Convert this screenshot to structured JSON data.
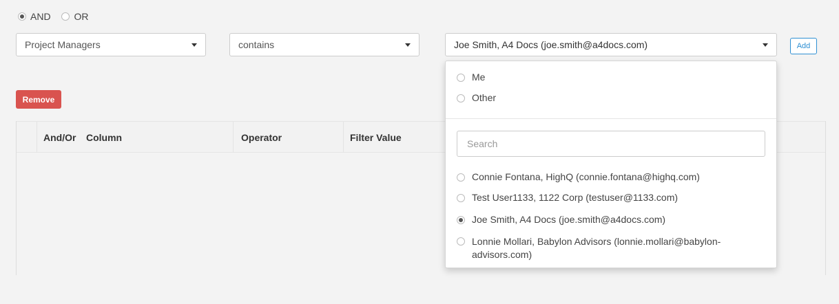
{
  "logic": {
    "options": [
      {
        "label": "AND",
        "checked": true
      },
      {
        "label": "OR",
        "checked": false
      }
    ]
  },
  "filter": {
    "column_value": "Project Managers",
    "operator_value": "contains",
    "filter_value": "Joe Smith, A4 Docs (joe.smith@a4docs.com)",
    "add_label": "Add",
    "remove_label": "Remove"
  },
  "table": {
    "headers": [
      "And/Or",
      "Column",
      "Operator",
      "Filter Value"
    ]
  },
  "dropdown": {
    "quick_options": [
      {
        "label": "Me",
        "checked": false
      },
      {
        "label": "Other",
        "checked": false
      }
    ],
    "search_placeholder": "Search",
    "users": [
      {
        "label": "Connie Fontana, HighQ (connie.fontana@highq.com)",
        "checked": false
      },
      {
        "label": "Test User1133, 1122 Corp (testuser@1133.com)",
        "checked": false
      },
      {
        "label": "Joe Smith, A4 Docs (joe.smith@a4docs.com)",
        "checked": true
      },
      {
        "label": "Lonnie Mollari, Babylon Advisors (lonnie.mollari@babylon-advisors.com)",
        "checked": false
      }
    ]
  },
  "colors": {
    "accent": "#2e8fd3",
    "danger": "#d9534f",
    "background": "#f3f3f3"
  }
}
